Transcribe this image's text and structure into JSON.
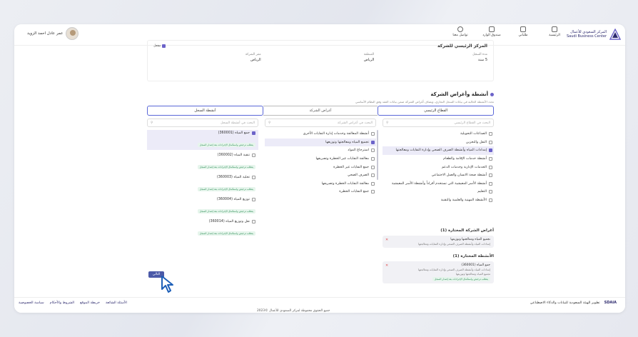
{
  "header": {
    "brand_ar": "المركز السعودي للأعمال",
    "brand_en": "Saudi Business Center",
    "nav": [
      {
        "label": "الرئيسية",
        "icon": "home-icon"
      },
      {
        "label": "طلباتي",
        "icon": "document-icon"
      },
      {
        "label": "صندوق الوارد",
        "icon": "inbox-icon"
      },
      {
        "label": "تواصل معنا",
        "icon": "contact-icon"
      }
    ],
    "user_name": "عمر عادل احمد الزويد"
  },
  "info": {
    "section_title": "المركز الرئيسي للشركة",
    "check_label": "مفعل",
    "fields": [
      {
        "label": "مدة السجل",
        "value": "5 سنة"
      },
      {
        "label": "المنطقة",
        "value": "الرياض"
      },
      {
        "label": "مقر الشركة",
        "value": "الرياض"
      }
    ]
  },
  "activities": {
    "title": "أنشطة وأغراض الشركة",
    "subtitle": "تحدد الأنشطة الحالية في بيانات السجل التجاري، ويضاف أغراض الشركة ضمن بيانات العقد وفق النظام الأساسي",
    "steps": [
      "القطاع الرئيسي",
      "أغراض الشركة",
      "أنشطة السجل"
    ],
    "search_sector": "البحث في القطاع الرئيسي",
    "search_purpose": "البحث في أغراض الشركة",
    "search_activity": "البحث في أنشطة السجل",
    "sectors": [
      {
        "label": "الصناعات التحويلية",
        "checked": false
      },
      {
        "label": "النقل والتخزين",
        "checked": false
      },
      {
        "label": "إمدادات المياه وأنشطة الصرف الصحي وإدارة النفايات ومعالجتها",
        "checked": true
      },
      {
        "label": "أنشطة خدمات الإقامة والطعام",
        "checked": false
      },
      {
        "label": "الخدمات الإدارية وخدمات الدعم",
        "checked": false
      },
      {
        "label": "أنشطة صحة الانسان والعمل الاجتماعي",
        "checked": false
      },
      {
        "label": "أنشطة الأسر المعيشية التي تستخدم أفراداً وأنشطة الأسر المعيشية",
        "checked": false
      },
      {
        "label": "التعليم",
        "checked": false
      },
      {
        "label": "الأنشطة المهنية والعلمية والتقنية",
        "checked": false
      }
    ],
    "purposes": [
      {
        "label": "أنشطة المعالجة وخدمات إدارة النفايات الأخرى",
        "checked": false
      },
      {
        "label": "تجميع المياه ومعالجتها وتوزيعها",
        "checked": true
      },
      {
        "label": "استرجاع المواد",
        "checked": false
      },
      {
        "label": "معالجة النفايات غير الخطرة وتصريفها",
        "checked": false
      },
      {
        "label": "جمع النفايات غير الخطرة",
        "checked": false
      },
      {
        "label": "الصرف الصحي",
        "checked": false
      },
      {
        "label": "معالجة النفايات الخطرة وتصريفها",
        "checked": false
      },
      {
        "label": "جمع النفايات الخطرة",
        "checked": false
      }
    ],
    "register": [
      {
        "label": "جمع المياه (360001)",
        "checked": true
      },
      {
        "label": "تنقية المياه (360002)",
        "checked": false
      },
      {
        "label": "تحلية المياه (360003)",
        "checked": false
      },
      {
        "label": "توزيع المياه (360004)",
        "checked": false
      },
      {
        "label": "نقل وتوزيع المياه (360014)",
        "checked": false
      }
    ],
    "register_tag": "يتطلب ترخيص واستكمال الإجراءات بعد إصدار السجل",
    "chosen_purposes_title": "أغراض الشركة المختارة (1)",
    "chosen_purpose": "تجميع المياه ومعالجتها وتوزيعها",
    "chosen_purpose_sub": "إمدادات المياه وأنشطة الصرف الصحي وإدارة النفايات ومعالجتها",
    "chosen_acts_title": "الأنشطة المختارة (1)",
    "chosen_act": "جمع المياه (360001)",
    "chosen_act_sub1": "إمدادات المياه وأنشطة الصرف الصحي وإدارة النفايات ومعالجتها",
    "chosen_act_sub2": "تجميع المياه ومعالجتها وتوزيعها",
    "chosen_act_tag": "يتطلب ترخيص واستكمال الإجراءات بعد إصدار السجل",
    "next_label": "التالي"
  },
  "footer": {
    "links": [
      "سياسة الخصوصية",
      "الشروط والأحكام",
      "خريطة الموقع",
      "الأسئلة الشائعة"
    ],
    "powered": "تطوير الهيئة السعودية للبيانات والذكاء الاصطناعي",
    "sdaia": "SDAIA",
    "copyright": "جميع الحقوق محفوظة لمركز السعودي للأعمال ©2023"
  },
  "colors": {
    "accent": "#6c63c9",
    "brand": "#2d2a6e",
    "button": "#4b5aa8"
  }
}
